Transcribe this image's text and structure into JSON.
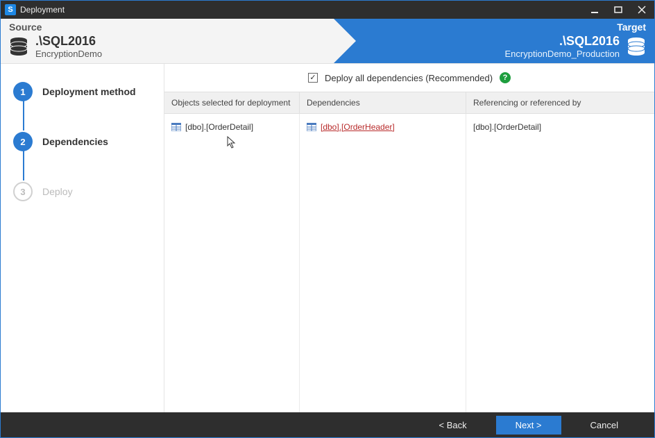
{
  "window": {
    "title": "Deployment"
  },
  "header": {
    "source_label": "Source",
    "target_label": "Target",
    "source": {
      "server": ".\\SQL2016",
      "database": "EncryptionDemo"
    },
    "target": {
      "server": ".\\SQL2016",
      "database": "EncryptionDemo_Production"
    }
  },
  "steps": {
    "s1": {
      "num": "1",
      "label": "Deployment method"
    },
    "s2": {
      "num": "2",
      "label": "Dependencies"
    },
    "s3": {
      "num": "3",
      "label": "Deploy"
    }
  },
  "content": {
    "deploy_all_label": "Deploy all dependencies (Recommended)",
    "col1_header": "Objects selected for deployment",
    "col2_header": "Dependencies",
    "col3_header": "Referencing or referenced by",
    "selected_object": "[dbo].[OrderDetail]",
    "dependency_link": "[dbo].[OrderHeader]",
    "referenced_by": "[dbo].[OrderDetail]"
  },
  "footer": {
    "back": "< Back",
    "next": "Next >",
    "cancel": "Cancel"
  }
}
